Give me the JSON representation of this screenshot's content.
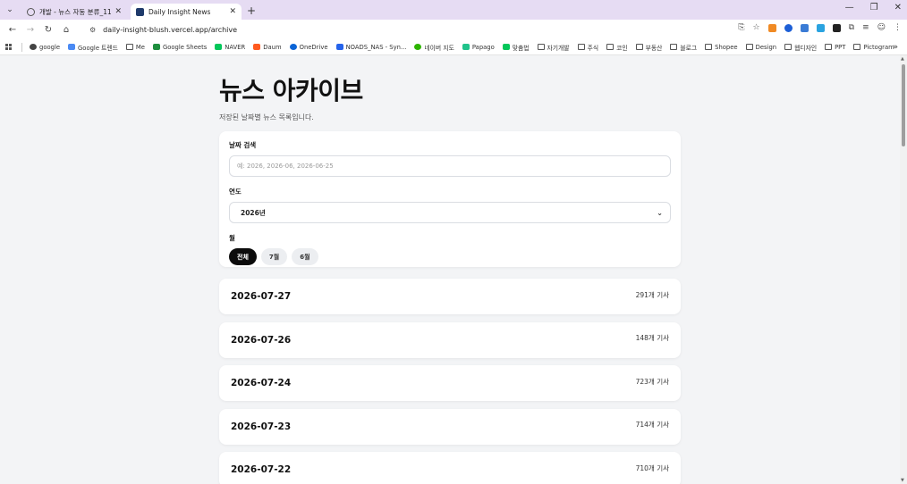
{
  "browser": {
    "tabs": [
      {
        "title": "개발 - 뉴스 자동 분류_11",
        "active": false
      },
      {
        "title": "Daily Insight News",
        "active": true
      }
    ],
    "url": "daily-insight-blush.vercel.app/archive",
    "bookmarks": [
      "google",
      "Google 트렌드",
      "Me",
      "Google Sheets",
      "NAVER",
      "Daum",
      "OneDrive",
      "NOADS_NAS - Syn...",
      "네이버 지도",
      "Papago",
      "맞춤법",
      "자기개발",
      "주식",
      "코인",
      "부동산",
      "블로그",
      "Shopee",
      "Design",
      "웹디자인",
      "PPT",
      "Pictogram"
    ],
    "bookmark_more": "»"
  },
  "page": {
    "title": "뉴스 아카이브",
    "subtitle": "저장된 날짜별 뉴스 목록입니다."
  },
  "filters": {
    "date_search_label": "날짜 검색",
    "date_search_placeholder": "예: 2026, 2026-06, 2026-06-25",
    "year_label": "연도",
    "year_selected": "2026년",
    "month_label": "월",
    "months": [
      {
        "label": "전체",
        "active": true
      },
      {
        "label": "7월",
        "active": false
      },
      {
        "label": "6월",
        "active": false
      }
    ]
  },
  "archive": [
    {
      "date": "2026-07-27",
      "count": "291개 기사"
    },
    {
      "date": "2026-07-26",
      "count": "148개 기사"
    },
    {
      "date": "2026-07-24",
      "count": "723개 기사"
    },
    {
      "date": "2026-07-23",
      "count": "714개 기사"
    },
    {
      "date": "2026-07-22",
      "count": "710개 기사"
    }
  ],
  "colors": {
    "accent": "#0b0b0b",
    "page_bg": "#f3f4f6",
    "tab_strip": "#e6dcf3"
  }
}
